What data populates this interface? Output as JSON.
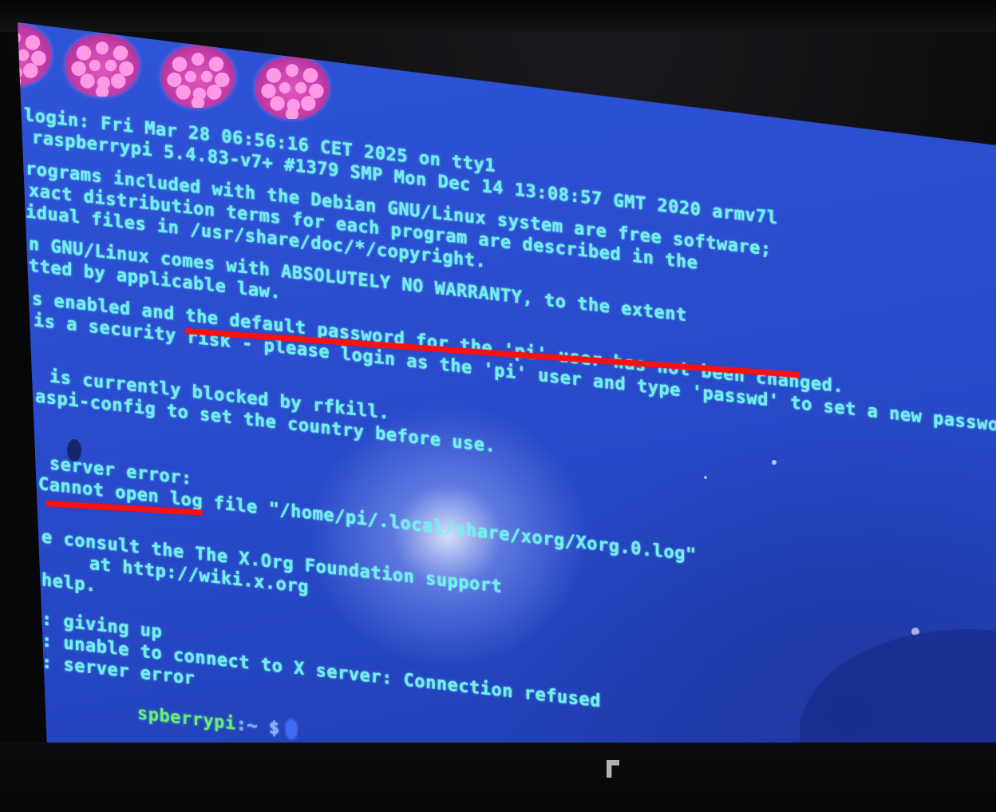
{
  "console": {
    "lines": [
      "login: Fri Mar 28 06:56:16 CET 2025 on tty1",
      "raspberrypi 5.4.83-v7+ #1379 SMP Mon Dec 14 13:08:57 GMT 2020 armv7l",
      "rograms included with the Debian GNU/Linux system are free software;",
      "xact distribution terms for each program are described in the",
      "idual files in /usr/share/doc/*/copyright.",
      "n GNU/Linux comes with ABSOLUTELY NO WARRANTY, to the extent",
      "tted by applicable law.",
      "s enabled and the default password for the 'pi' user has not been changed.",
      "is a security risk - please login as the 'pi' user and type 'passwd' to set a new password.",
      "is currently blocked by rfkill.",
      "aspi-config to set the country before use.",
      "server error:",
      "Cannot open log file \"/home/pi/.local/share/xorg/Xorg.0.log\"",
      "e consult the The X.Org Foundation support",
      "at http://wiki.x.org",
      "help.",
      ": giving up",
      ": unable to connect to X server: Connection refused",
      ": server error"
    ],
    "prompt_host": "spberrypi",
    "prompt_rest": ":~ $"
  }
}
